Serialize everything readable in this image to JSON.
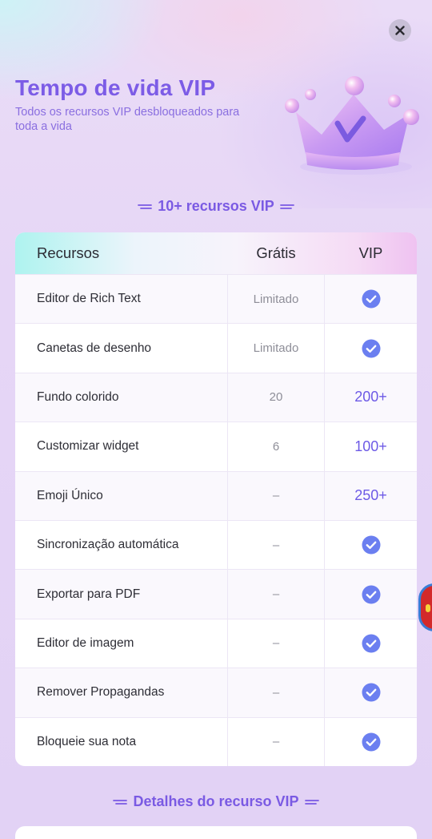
{
  "header": {
    "title": "Tempo de vida VIP",
    "subtitle": "Todos os recursos VIP desbloqueados para toda a vida"
  },
  "section1": {
    "title": "10+ recursos VIP"
  },
  "table": {
    "headers": [
      "Recursos",
      "Grátis",
      "VIP"
    ],
    "rows": [
      {
        "feature": "Editor de Rich Text",
        "free": "Limitado",
        "vip": "check"
      },
      {
        "feature": "Canetas de desenho",
        "free": "Limitado",
        "vip": "check"
      },
      {
        "feature": "Fundo colorido",
        "free": "20",
        "vip": "200+"
      },
      {
        "feature": "Customizar widget",
        "free": "6",
        "vip": "100+"
      },
      {
        "feature": "Emoji Único",
        "free": "–",
        "vip": "250+"
      },
      {
        "feature": "Sincronização automática",
        "free": "–",
        "vip": "check"
      },
      {
        "feature": "Exportar para PDF",
        "free": "–",
        "vip": "check"
      },
      {
        "feature": "Editor de imagem",
        "free": "–",
        "vip": "check"
      },
      {
        "feature": "Remover Propagandas",
        "free": "–",
        "vip": "check"
      },
      {
        "feature": "Bloqueie sua nota",
        "free": "–",
        "vip": "check"
      }
    ]
  },
  "section2": {
    "title": "Detalhes do recurso VIP"
  },
  "colors": {
    "accent": "#7c5ce6",
    "check": "#6b7ff0"
  }
}
